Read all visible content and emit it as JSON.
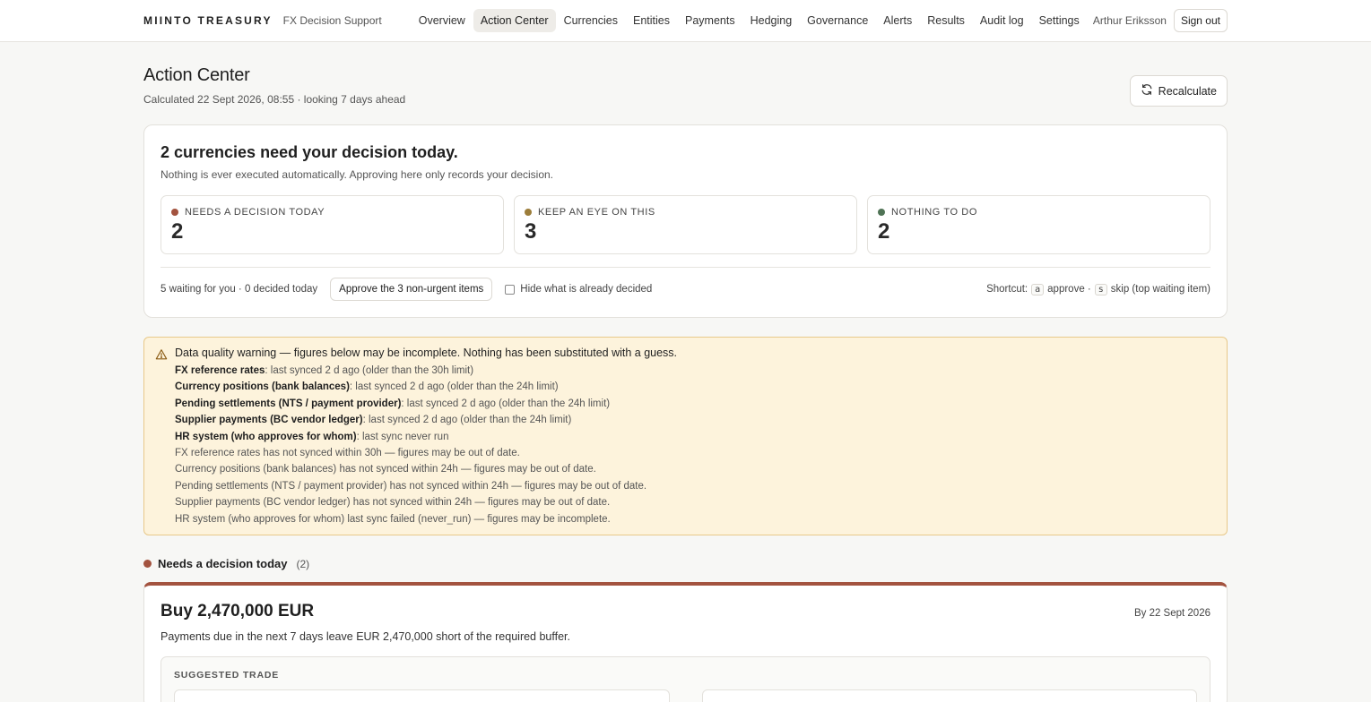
{
  "header": {
    "brand": "MIINTO TREASURY",
    "brand_sub": "FX Decision Support",
    "nav": [
      {
        "label": "Overview"
      },
      {
        "label": "Action Center",
        "active": true
      },
      {
        "label": "Currencies"
      },
      {
        "label": "Entities"
      },
      {
        "label": "Payments"
      },
      {
        "label": "Hedging"
      },
      {
        "label": "Governance"
      },
      {
        "label": "Alerts"
      },
      {
        "label": "Results"
      },
      {
        "label": "Audit log"
      },
      {
        "label": "Settings"
      }
    ],
    "user_name": "Arthur Eriksson",
    "sign_out": "Sign out"
  },
  "page": {
    "title": "Action Center",
    "subtitle": "Calculated 22 Sept 2026, 08:55 · looking 7 days ahead",
    "recalculate": "Recalculate",
    "recalculate_icon": "refresh-icon"
  },
  "summary": {
    "title": "2 currencies need your decision today.",
    "subtitle": "Nothing is ever executed automatically. Approving here only records your decision.",
    "stats": [
      {
        "label": "NEEDS A DECISION TODAY",
        "value": "2",
        "color": "#a3533f"
      },
      {
        "label": "KEEP AN EYE ON THIS",
        "value": "3",
        "color": "#9c7d3a"
      },
      {
        "label": "NOTHING TO DO",
        "value": "2",
        "color": "#4f7355"
      }
    ],
    "waiting": "5 waiting for you · 0 decided today",
    "approve_button": "Approve the 3 non-urgent items",
    "hide_label": "Hide what is already decided",
    "hide_checked": false,
    "shortcut_prefix": "Shortcut:",
    "shortcut_key_a": "a",
    "shortcut_approve": "approve ·",
    "shortcut_key_s": "s",
    "shortcut_skip": "skip (top waiting item)"
  },
  "warning": {
    "icon": "warning-triangle-icon",
    "title": "Data quality warning — figures below may be incomplete. Nothing has been substituted with a guess.",
    "sources": [
      {
        "name": "FX reference rates",
        "detail": ": last synced 2 d ago (older than the 30h limit)"
      },
      {
        "name": "Currency positions (bank balances)",
        "detail": ": last synced 2 d ago (older than the 24h limit)"
      },
      {
        "name": "Pending settlements (NTS / payment provider)",
        "detail": ": last synced 2 d ago (older than the 24h limit)"
      },
      {
        "name": "Supplier payments (BC vendor ledger)",
        "detail": ": last synced 2 d ago (older than the 24h limit)"
      },
      {
        "name": "HR system (who approves for whom)",
        "detail": ": last sync never run"
      }
    ],
    "notes": [
      "FX reference rates has not synced within 30h — figures may be out of date.",
      "Currency positions (bank balances) has not synced within 24h — figures may be out of date.",
      "Pending settlements (NTS / payment provider) has not synced within 24h — figures may be out of date.",
      "Supplier payments (BC vendor ledger) has not synced within 24h — figures may be out of date.",
      "HR system (who approves for whom) last sync failed (never_run) — figures may be incomplete."
    ]
  },
  "section": {
    "title": "Needs a decision today",
    "count": "(2)",
    "color": "#a3533f"
  },
  "decision": {
    "title": "Buy 2,470,000 EUR",
    "date": "By 22 Sept 2026",
    "description": "Payments due in the next 7 days leave EUR 2,470,000 short of the required buffer.",
    "trade_label": "SUGGESTED TRADE"
  }
}
